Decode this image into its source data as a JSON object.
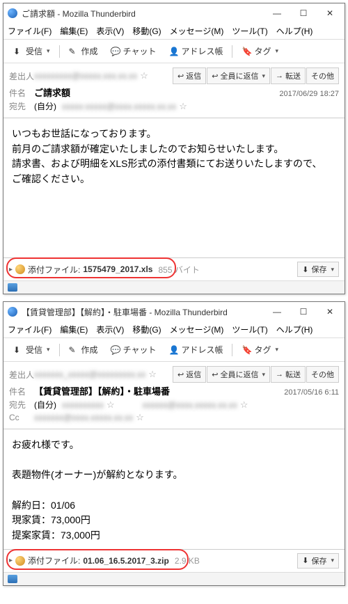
{
  "windows": [
    {
      "title": "ご請求額 - Mozilla Thunderbird",
      "menu": {
        "file": "ファイル(F)",
        "edit": "編集(E)",
        "view": "表示(V)",
        "go": "移動(G)",
        "message": "メッセージ(M)",
        "tools": "ツール(T)",
        "help": "ヘルプ(H)"
      },
      "toolbar": {
        "receive": "受信",
        "compose": "作成",
        "chat": "チャット",
        "address": "アドレス帳",
        "tag": "タグ"
      },
      "reply_btns": {
        "reply": "返信",
        "reply_all": "全員に返信",
        "forward": "転送",
        "other": "その他"
      },
      "labels": {
        "from": "差出人",
        "subject": "件名",
        "to": "宛先"
      },
      "subject": "ご請求額",
      "date": "2017/06/29 18:27",
      "to": "(自分)",
      "body_lines": [
        "いつもお世話になっております。",
        "前月のご請求額が確定いたしましたのでお知らせいたします。",
        "請求書、および明細をXLS形式の添付書類にてお送りいたしますので、",
        "ご確認ください。"
      ],
      "attachment": {
        "label": "添付ファイル:",
        "name": "1575479_2017.xls",
        "size": "855 バイト",
        "save": "保存"
      }
    },
    {
      "title": "【賃貸管理部】【解約】・駐車場番 - Mozilla Thunderbird",
      "menu": {
        "file": "ファイル(F)",
        "edit": "編集(E)",
        "view": "表示(V)",
        "go": "移動(G)",
        "message": "メッセージ(M)",
        "tools": "ツール(T)",
        "help": "ヘルプ(H)"
      },
      "toolbar": {
        "receive": "受信",
        "compose": "作成",
        "chat": "チャット",
        "address": "アドレス帳",
        "tag": "タグ"
      },
      "reply_btns": {
        "reply": "返信",
        "reply_all": "全員に返信",
        "forward": "転送",
        "other": "その他"
      },
      "labels": {
        "from": "差出人",
        "subject": "件名",
        "to": "宛先",
        "cc": "Cc"
      },
      "subject": "【賃貸管理部】【解約】・駐車場番",
      "date": "2017/05/16 6:11",
      "to": "(自分)",
      "body_lines": [
        "お疲れ様です。",
        "",
        "表題物件(オーナー)が解約となります。",
        "",
        "解約日：01/06",
        "現家賃：73,000円",
        "提案家賃：73,000円"
      ],
      "attachment": {
        "label": "添付ファイル:",
        "name": "01.06_16.5.2017_3.zip",
        "size": "2.9 KB",
        "save": "保存"
      }
    }
  ]
}
